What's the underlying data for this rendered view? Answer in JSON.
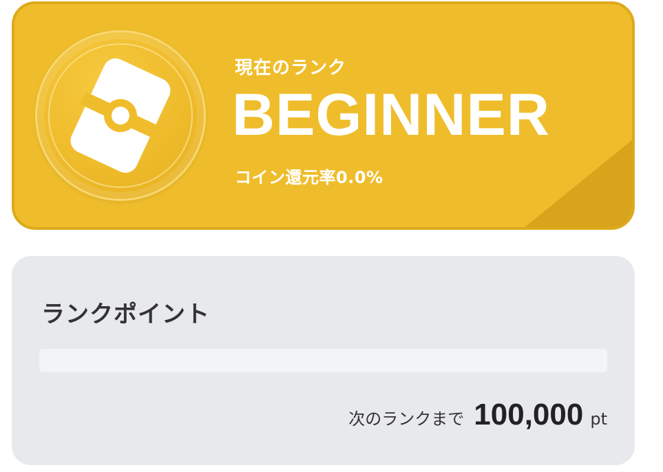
{
  "rank_card": {
    "caption": "現在のランク",
    "rank_name": "BEGINNER",
    "coin_rate": "コイン還元率0.0%",
    "emblem_icon": "rank-emblem-icon",
    "colors": {
      "background": "#efbd2b",
      "corner": "#d7a41c",
      "text": "#ffffff"
    }
  },
  "points_card": {
    "title": "ランクポイント",
    "progress_fraction": 0,
    "next_rank_label": "次のランクまで",
    "next_rank_value": "100,000",
    "unit": "pt",
    "colors": {
      "background": "#e8e9ed",
      "track": "#f2f4f8"
    }
  }
}
